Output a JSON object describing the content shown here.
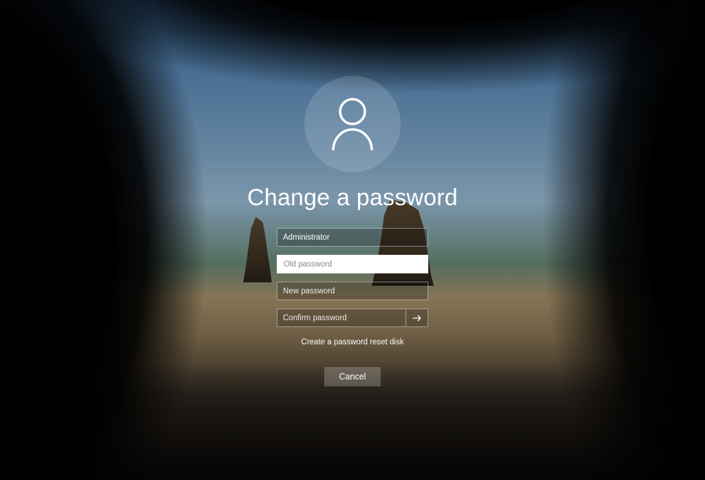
{
  "title": "Change a password",
  "username": {
    "value": "Administrator"
  },
  "old_password": {
    "placeholder": "Old password",
    "value": ""
  },
  "new_password": {
    "placeholder": "New password",
    "value": ""
  },
  "confirm_password": {
    "placeholder": "Confirm password",
    "value": ""
  },
  "reset_link": "Create a password reset disk",
  "cancel_label": "Cancel"
}
